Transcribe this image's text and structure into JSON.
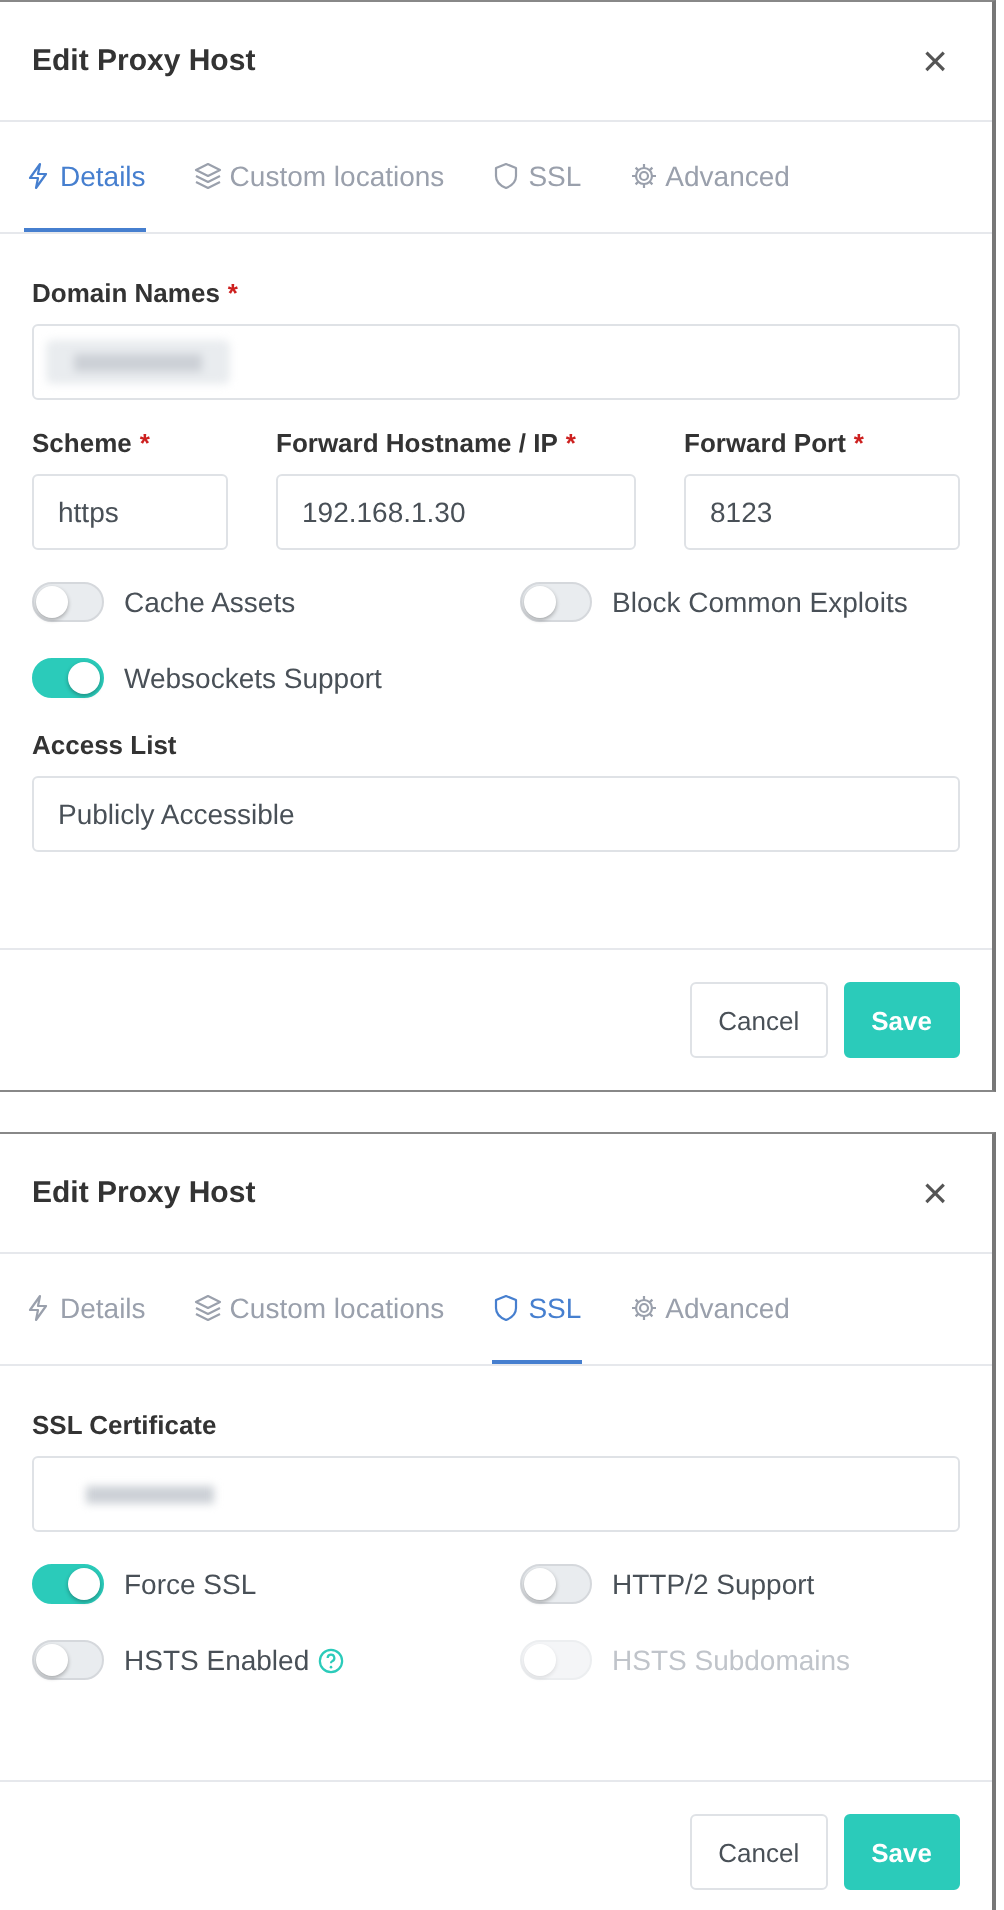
{
  "dialogs": [
    {
      "title": "Edit Proxy Host",
      "close": "×",
      "tabs": [
        {
          "label": "Details",
          "kind": "bolt",
          "selected": true
        },
        {
          "label": "Custom locations",
          "kind": "layers",
          "selected": false
        },
        {
          "label": "SSL",
          "kind": "shield",
          "selected": false
        },
        {
          "label": "Advanced",
          "kind": "gear",
          "selected": false
        }
      ],
      "content": [
        {
          "kind": "fields",
          "fields": [
            {
              "label": "Domain Names",
              "required_mark": "*",
              "kind": "tags",
              "redacted": true
            }
          ]
        },
        {
          "kind": "fields",
          "fields": [
            {
              "label": "Scheme",
              "required_mark": "*",
              "kind": "text",
              "value": "https"
            },
            {
              "label": "Forward Hostname / IP",
              "required_mark": "*",
              "kind": "text",
              "value": "192.168.1.30"
            },
            {
              "label": "Forward Port",
              "required_mark": "*",
              "kind": "text",
              "value": "8123"
            }
          ]
        },
        {
          "kind": "toggles",
          "toggles": [
            {
              "label": "Cache Assets",
              "on": false,
              "disabled": false,
              "help": false
            },
            {
              "label": "Block Common Exploits",
              "on": false,
              "disabled": false,
              "help": false
            }
          ]
        },
        {
          "kind": "toggles",
          "toggles": [
            {
              "label": "Websockets Support",
              "on": true,
              "disabled": false,
              "help": false
            }
          ]
        },
        {
          "kind": "fields",
          "fields": [
            {
              "label": "Access List",
              "kind": "text",
              "value": "Publicly Accessible"
            }
          ]
        }
      ],
      "buttons": [
        {
          "label": "Cancel",
          "kind": "secondary"
        },
        {
          "label": "Save",
          "kind": "primary"
        }
      ]
    },
    {
      "title": "Edit Proxy Host",
      "close": "×",
      "tabs": [
        {
          "label": "Details",
          "kind": "bolt",
          "selected": false
        },
        {
          "label": "Custom locations",
          "kind": "layers",
          "selected": false
        },
        {
          "label": "SSL",
          "kind": "shield",
          "selected": true
        },
        {
          "label": "Advanced",
          "kind": "gear",
          "selected": false
        }
      ],
      "content": [
        {
          "kind": "fields",
          "fields": [
            {
              "label": "SSL Certificate",
              "kind": "text",
              "redacted": true
            }
          ]
        },
        {
          "kind": "toggles",
          "toggles": [
            {
              "label": "Force SSL",
              "on": true,
              "disabled": false,
              "help": false
            },
            {
              "label": "HTTP/2 Support",
              "on": false,
              "disabled": false,
              "help": false
            }
          ]
        },
        {
          "kind": "toggles",
          "toggles": [
            {
              "label": "HSTS Enabled",
              "on": false,
              "disabled": false,
              "help": true
            },
            {
              "label": "HSTS Subdomains",
              "on": false,
              "disabled": true,
              "help": false
            }
          ]
        }
      ],
      "buttons": [
        {
          "label": "Cancel",
          "kind": "secondary"
        },
        {
          "label": "Save",
          "kind": "primary"
        }
      ]
    }
  ]
}
